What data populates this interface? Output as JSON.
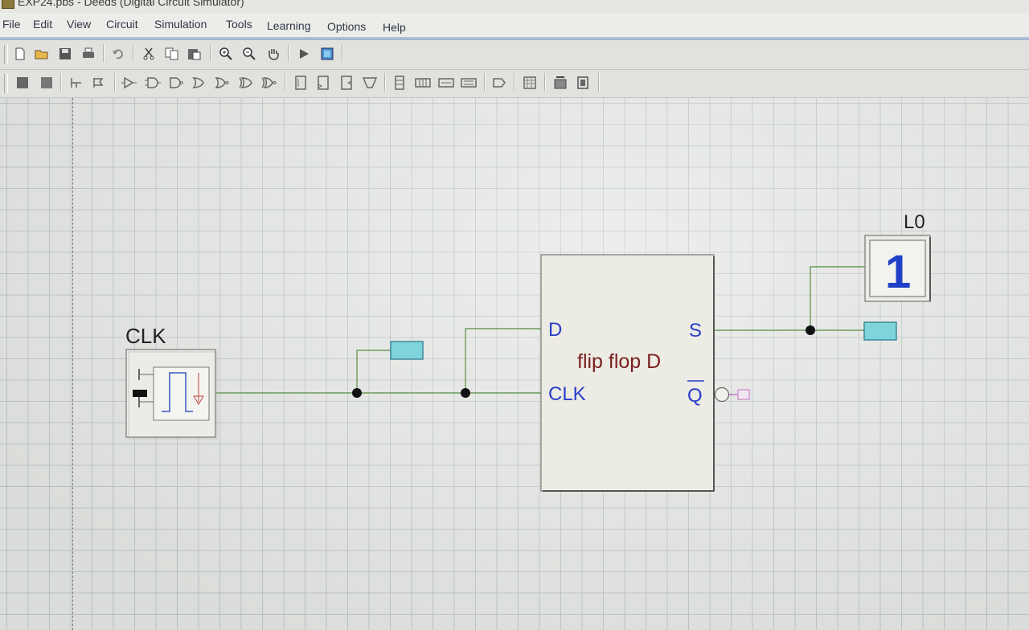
{
  "window": {
    "title": "EXP24.pbs - Deeds (Digital Circuit Simulator)"
  },
  "menu": {
    "items": [
      "File",
      "Edit",
      "View",
      "Circuit",
      "Simulation",
      "Tools",
      "Learning",
      "Options",
      "Help"
    ]
  },
  "toolbar1": {
    "buttons": [
      "new-file",
      "open-folder",
      "save",
      "print",
      "undo",
      "cut",
      "copy",
      "paste",
      "zoom-in",
      "zoom-out",
      "pan-hand",
      "run-simulation",
      "timing-diagram"
    ]
  },
  "toolbar2": {
    "buttons": [
      "input-switch",
      "output-led",
      "wire-split",
      "bus",
      "buffer",
      "and-gate",
      "nand-gate",
      "or-gate",
      "nor-gate",
      "xor-gate",
      "xnor-gate",
      "flipflop",
      "d-flipflop",
      "jk-flipflop",
      "mux",
      "register",
      "counter",
      "decoder",
      "memory",
      "arrow-block",
      "fsm",
      "ram",
      "rom"
    ]
  },
  "canvas": {
    "clock": {
      "label": "CLK"
    },
    "flipflop": {
      "title": "flip flop D",
      "input_d": "D",
      "input_clk": "CLK",
      "output_s": "S",
      "output_qbar": "Q"
    },
    "led": {
      "label": "L0",
      "value": "1"
    }
  },
  "colors": {
    "wire": "#6d9a5a",
    "pin_label": "#2b3ec8",
    "component_title": "#7a2020",
    "probe_fill": "#7fd4dc",
    "led_digit": "#2040c8"
  }
}
